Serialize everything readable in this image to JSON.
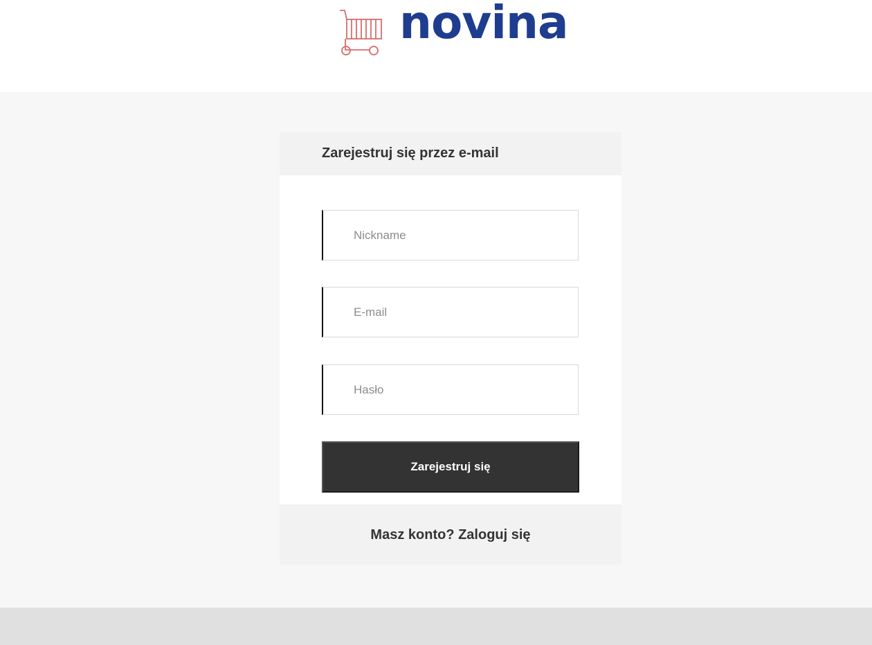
{
  "header": {
    "logo_text": "novina",
    "logo_icon": "shopping-cart-icon",
    "logo_color": "#1f3d8f",
    "cart_color": "#d96b6b"
  },
  "register": {
    "title": "Zarejestruj się przez e-mail",
    "nickname_placeholder": "Nickname",
    "email_placeholder": "E-mail",
    "password_placeholder": "Hasło",
    "submit_label": "Zarejestruj się",
    "submit_color": "#333333",
    "login_link": "Masz konto? Zaloguj się"
  }
}
